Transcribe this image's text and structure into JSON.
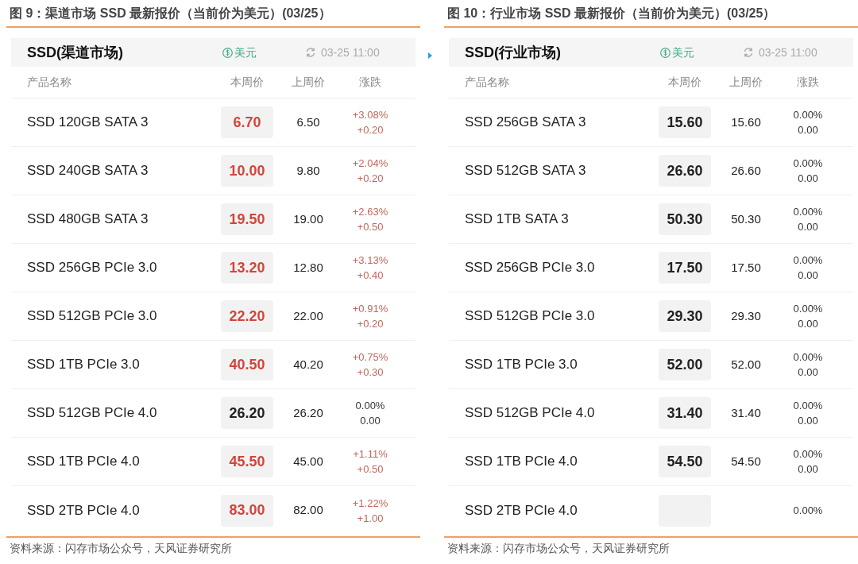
{
  "panels": [
    {
      "figure_title": "图 9：渠道市场 SSD 最新报价（当前价为美元）(03/25）",
      "card_title": "SSD(渠道市场)",
      "currency": "美元",
      "updated": "03-25 11:00",
      "columns": [
        "产品名称",
        "本周价",
        "上周价",
        "涨跌"
      ],
      "rows": [
        {
          "name": "SSD 120GB SATA 3",
          "price": "6.70",
          "prev": "6.50",
          "pct": "+3.08%",
          "diff": "+0.20",
          "kind": "up"
        },
        {
          "name": "SSD 240GB SATA 3",
          "price": "10.00",
          "prev": "9.80",
          "pct": "+2.04%",
          "diff": "+0.20",
          "kind": "up"
        },
        {
          "name": "SSD 480GB SATA 3",
          "price": "19.50",
          "prev": "19.00",
          "pct": "+2.63%",
          "diff": "+0.50",
          "kind": "up"
        },
        {
          "name": "SSD 256GB PCIe 3.0",
          "price": "13.20",
          "prev": "12.80",
          "pct": "+3.13%",
          "diff": "+0.40",
          "kind": "up"
        },
        {
          "name": "SSD 512GB PCIe 3.0",
          "price": "22.20",
          "prev": "22.00",
          "pct": "+0.91%",
          "diff": "+0.20",
          "kind": "up"
        },
        {
          "name": "SSD 1TB PCIe 3.0",
          "price": "40.50",
          "prev": "40.20",
          "pct": "+0.75%",
          "diff": "+0.30",
          "kind": "up"
        },
        {
          "name": "SSD 512GB PCIe 4.0",
          "price": "26.20",
          "prev": "26.20",
          "pct": "0.00%",
          "diff": "0.00",
          "kind": "flat"
        },
        {
          "name": "SSD 1TB PCIe 4.0",
          "price": "45.50",
          "prev": "45.00",
          "pct": "+1.11%",
          "diff": "+0.50",
          "kind": "up"
        },
        {
          "name": "SSD 2TB PCIe 4.0",
          "price": "83.00",
          "prev": "82.00",
          "pct": "+1.22%",
          "diff": "+1.00",
          "kind": "up"
        }
      ],
      "source": "资料来源：闪存市场公众号，天风证券研究所"
    },
    {
      "figure_title": "图 10：行业市场 SSD 最新报价（当前价为美元）(03/25）",
      "card_title": "SSD(行业市场)",
      "currency": "美元",
      "updated": "03-25 11:00",
      "columns": [
        "产品名称",
        "本周价",
        "上周价",
        "涨跌"
      ],
      "rows": [
        {
          "name": "SSD 256GB SATA 3",
          "price": "15.60",
          "prev": "15.60",
          "pct": "0.00%",
          "diff": "0.00",
          "kind": "flat"
        },
        {
          "name": "SSD 512GB SATA 3",
          "price": "26.60",
          "prev": "26.60",
          "pct": "0.00%",
          "diff": "0.00",
          "kind": "flat"
        },
        {
          "name": "SSD 1TB SATA 3",
          "price": "50.30",
          "prev": "50.30",
          "pct": "0.00%",
          "diff": "0.00",
          "kind": "flat"
        },
        {
          "name": "SSD 256GB PCIe 3.0",
          "price": "17.50",
          "prev": "17.50",
          "pct": "0.00%",
          "diff": "0.00",
          "kind": "flat"
        },
        {
          "name": "SSD 512GB PCIe 3.0",
          "price": "29.30",
          "prev": "29.30",
          "pct": "0.00%",
          "diff": "0.00",
          "kind": "flat"
        },
        {
          "name": "SSD 1TB PCIe 3.0",
          "price": "52.00",
          "prev": "52.00",
          "pct": "0.00%",
          "diff": "0.00",
          "kind": "flat"
        },
        {
          "name": "SSD 512GB PCIe 4.0",
          "price": "31.40",
          "prev": "31.40",
          "pct": "0.00%",
          "diff": "0.00",
          "kind": "flat"
        },
        {
          "name": "SSD 1TB PCIe 4.0",
          "price": "54.50",
          "prev": "54.50",
          "pct": "0.00%",
          "diff": "0.00",
          "kind": "flat"
        },
        {
          "name": "SSD 2TB PCIe 4.0",
          "pct": "0.00%",
          "kind": "flat"
        }
      ],
      "source": "资料来源：闪存市场公众号，天风证券研究所"
    }
  ]
}
